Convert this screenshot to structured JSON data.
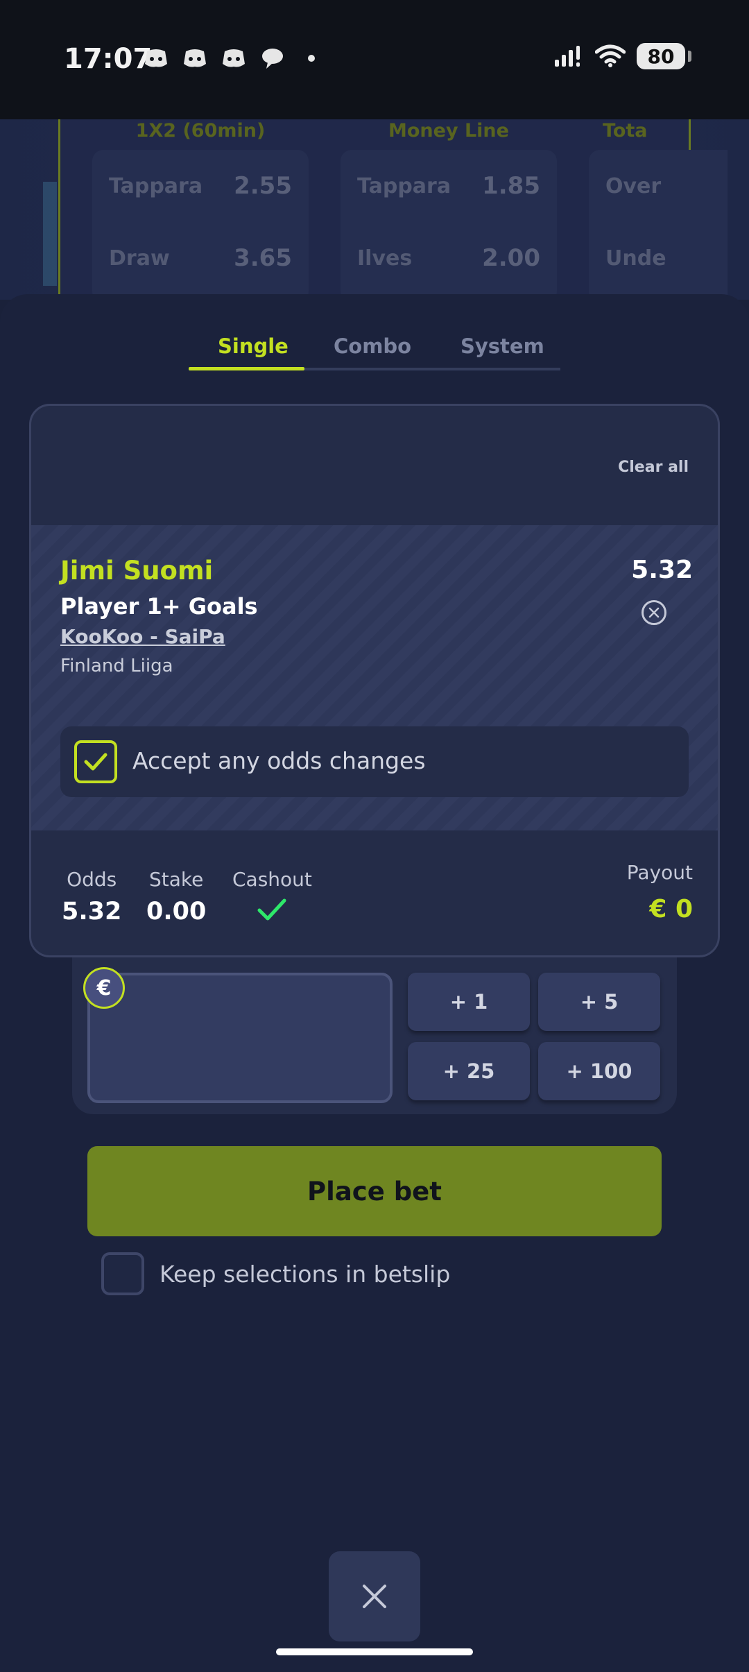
{
  "status_bar": {
    "time": "17:07",
    "battery": "80",
    "icons": [
      "discord-icon",
      "discord-icon",
      "discord-icon",
      "chat-bubble-icon",
      "dot-icon",
      "signal-icon",
      "wifi-icon",
      "battery-icon"
    ]
  },
  "markets": [
    {
      "title": "1X2 (60min)",
      "rows": [
        {
          "name": "Tappara",
          "odd": "2.55"
        },
        {
          "name": "Draw",
          "odd": "3.65"
        }
      ]
    },
    {
      "title": "Money Line",
      "rows": [
        {
          "name": "Tappara",
          "odd": "1.85"
        },
        {
          "name": "Ilves",
          "odd": "2.00"
        }
      ]
    },
    {
      "title": "Tota",
      "rows": [
        {
          "name": "Over",
          "odd": ""
        },
        {
          "name": "Unde",
          "odd": ""
        }
      ]
    }
  ],
  "tabs": [
    {
      "label": "Single",
      "active": true
    },
    {
      "label": "Combo",
      "active": false
    },
    {
      "label": "System",
      "active": false
    }
  ],
  "betslip": {
    "clear_all": "Clear all",
    "selection": {
      "player": "Jimi Suomi",
      "market": "Player 1+ Goals",
      "match": "KooKoo - SaiPa",
      "league": "Finland Liiga",
      "odds": "5.32"
    },
    "accept_odds": {
      "label": "Accept any odds changes",
      "checked": true
    },
    "summary": {
      "odds_label": "Odds",
      "odds_value": "5.32",
      "stake_label": "Stake",
      "stake_value": "0.00",
      "cashout_label": "Cashout",
      "payout_label": "Payout",
      "payout_value": "€  0"
    }
  },
  "stake": {
    "currency": "€",
    "quick_amounts": [
      "+ 1",
      "+ 5",
      "+ 25",
      "+ 100"
    ]
  },
  "place_bet": "Place bet",
  "keep_selections": {
    "label": "Keep selections in betslip",
    "checked": false
  },
  "colors": {
    "accent": "#c3e021",
    "place_bet": "#6f8621",
    "background": "#1b223c",
    "cashout_check": "#2ee86a"
  }
}
